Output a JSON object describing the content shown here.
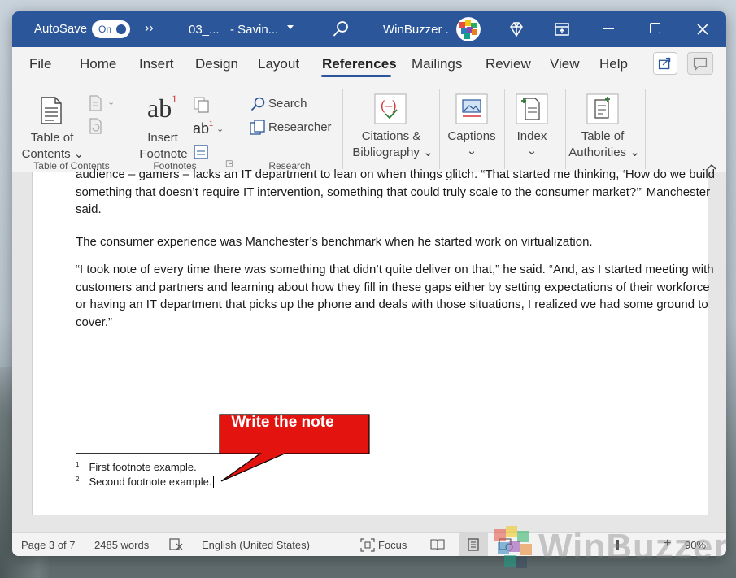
{
  "titlebar": {
    "autosave_label": "AutoSave",
    "autosave_state": "On",
    "more_glyph": "››",
    "doc_name": "03_...",
    "save_status": "-  Savin...",
    "user_name": "WinBuzzer ."
  },
  "tabs": [
    {
      "label": "File"
    },
    {
      "label": "Home"
    },
    {
      "label": "Insert"
    },
    {
      "label": "Design"
    },
    {
      "label": "Layout"
    },
    {
      "label": "References"
    },
    {
      "label": "Mailings"
    },
    {
      "label": "Review"
    },
    {
      "label": "View"
    },
    {
      "label": "Help"
    }
  ],
  "active_tab": "References",
  "ribbon": {
    "toc": {
      "line1": "Table of",
      "line2": "Contents",
      "group_label": "Table of Contents"
    },
    "footnotes": {
      "line1": "Insert",
      "line2": "Footnote",
      "group_label": "Footnotes"
    },
    "research": {
      "search": "Search",
      "researcher": "Researcher",
      "group_label": "Research"
    },
    "citations": {
      "line1": "Citations &",
      "line2": "Bibliography"
    },
    "captions": {
      "line1": "Captions"
    },
    "index": {
      "line1": "Index"
    },
    "authorities": {
      "line1": "Table of",
      "line2": "Authorities"
    }
  },
  "document": {
    "para1": "audience – gamers – lacks an IT department to lean on when things glitch. “That started me thinking, ‘How do we build something that doesn’t require IT intervention, something that could truly scale to the consumer market?’” Manchester said.",
    "para2": "The consumer experience was Manchester’s benchmark when he started work on virtualization.",
    "para3": "“I took note of every time there was something that didn’t quite deliver on that,” he said. “And, as I started meeting with customers and partners and learning about how they fill in these gaps either by setting expectations of their workforce or having an IT department that picks up the phone and deals with those situations, I realized we had some ground to cover.”",
    "footnotes": [
      {
        "num": "1",
        "text": "First footnote example."
      },
      {
        "num": "2",
        "text": "Second footnote example."
      }
    ]
  },
  "callout": {
    "text": "Write the note",
    "color": "#e3130f"
  },
  "statusbar": {
    "page": "Page 3 of 7",
    "words": "2485 words",
    "language": "English (United States)",
    "focus": "Focus",
    "zoom_plus": "+",
    "zoom": "90%"
  },
  "watermark": {
    "text": "WinBuzzer"
  },
  "colors": {
    "accent": "#2b579a",
    "callout": "#e3130f"
  }
}
